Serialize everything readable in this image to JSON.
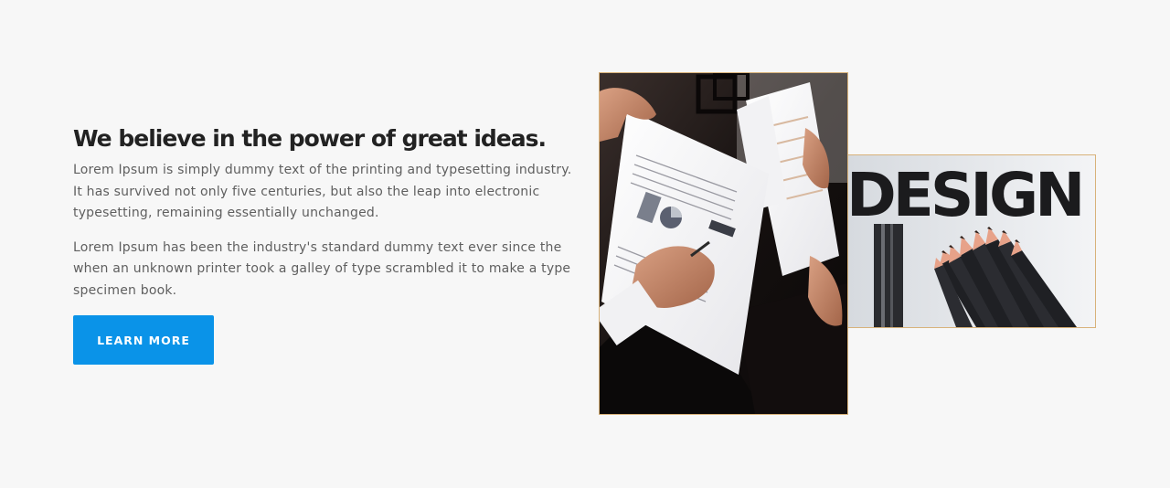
{
  "section": {
    "headline": "We believe in the power of great ideas.",
    "paragraphs": [
      "Lorem Ipsum is simply dummy text of the printing and typesetting industry. It has survived not only five centuries, but also the leap into electronic typesetting, remaining essentially unchanged.",
      "Lorem Ipsum has been the industry's standard dummy text ever since the when an unknown printer took a galley of type scrambled it to make a type specimen book."
    ],
    "cta_label": "LEARN MORE"
  },
  "images": {
    "design_word": "DESIGN"
  },
  "colors": {
    "background": "#f7f7f7",
    "headline": "#222222",
    "body_text": "#5f5f5f",
    "button": "#0a93e8",
    "image_border": "#d8b27a"
  }
}
